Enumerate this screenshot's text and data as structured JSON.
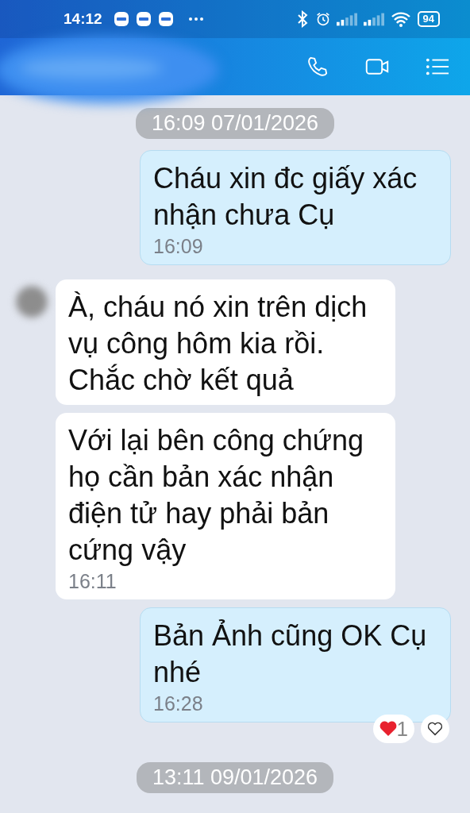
{
  "status_bar": {
    "time": "14:12",
    "battery": "94"
  },
  "messages": [
    {
      "kind": "date",
      "text": "16:09 07/01/2026"
    },
    {
      "kind": "sent",
      "text": "Cháu xin đc giấy xác nhận chưa Cụ",
      "time": "16:09"
    },
    {
      "kind": "received",
      "text": "À, cháu nó xin trên dịch vụ công hôm kia rồi. Chắc chờ kết quả",
      "avatar": true
    },
    {
      "kind": "received",
      "text": "Với lại bên công chứng họ cần bản xác nhận điện tử hay phải bản cứng vậy",
      "time": "16:11"
    },
    {
      "kind": "sent",
      "text": "Bản Ảnh cũng OK Cụ nhé",
      "time": "16:28",
      "reaction_count": "1"
    },
    {
      "kind": "date",
      "text": "13:11 09/01/2026"
    }
  ]
}
